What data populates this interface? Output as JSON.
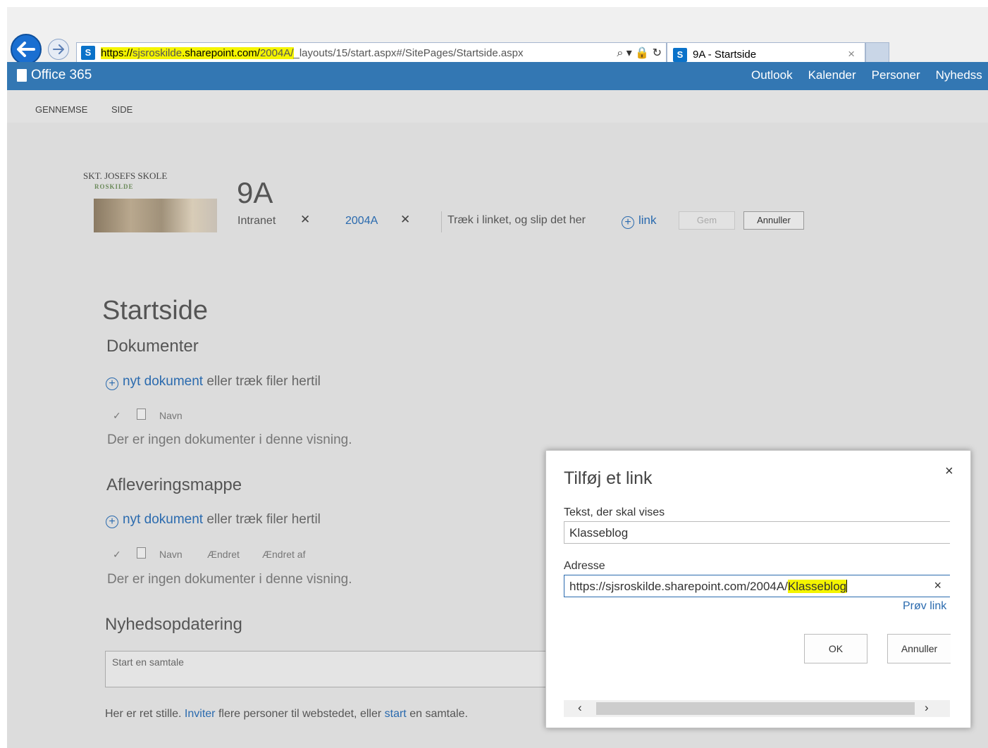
{
  "browser": {
    "url_parts": {
      "a": "https://",
      "b": "sjsroskilde",
      "c": ".sharepoint.com/",
      "d": "2004A/",
      "e": "_layouts/15/start.aspx#/SitePages/Startside.aspx"
    },
    "address_tools": "⌕ ▾ 🔒 ↻",
    "tab_title": "9A - Startside",
    "tab_close": "×",
    "icons": [
      "back-arrow-icon",
      "forward-arrow-icon",
      "sharepoint-icon",
      "search-icon",
      "lock-icon",
      "refresh-icon",
      "close-icon"
    ]
  },
  "suite": {
    "brand": "Office 365",
    "nav": [
      "Outlook",
      "Kalender",
      "Personer",
      "Nyhedss"
    ]
  },
  "ribbon": {
    "tabs": [
      "GENNEMSE",
      "SIDE"
    ]
  },
  "site": {
    "logo_line1": "SKT. JOSEFS SKOLE",
    "logo_line2": "ROSKILDE",
    "title": "9A",
    "breadcrumb_1": "Intranet",
    "breadcrumb_2": "2004A",
    "remove_glyph": "✕",
    "drag_hint": "Træk i linket, og slip det her",
    "add_link": "link",
    "save": "Gem",
    "cancel": "Annuller"
  },
  "main": {
    "page_title": "Startside",
    "sections": [
      {
        "title": "Dokumenter",
        "new_link": "nyt dokument",
        "new_rest": " eller træk filer hertil",
        "columns": [
          "Navn"
        ],
        "empty": "Der er ingen dokumenter i denne visning."
      },
      {
        "title": "Afleveringsmappe",
        "new_link": "nyt dokument",
        "new_rest": " eller træk filer hertil",
        "columns": [
          "Navn",
          "Ændret",
          "Ændret af"
        ],
        "empty": "Der er ingen dokumenter i denne visning."
      }
    ],
    "news_title": "Nyhedsopdatering",
    "conversation_placeholder": "Start en samtale",
    "footer": {
      "p1": "Her er ret stille. ",
      "invite": "Inviter",
      "p2": " flere personer til webstedet, eller ",
      "start": "start",
      "p3": " en samtale."
    }
  },
  "dialog": {
    "title": "Tilføj et link",
    "close": "×",
    "text_label": "Tekst, der skal vises",
    "text_value": "Klasseblog",
    "address_label": "Adresse",
    "address_prefix": "https://sjsroskilde.sharepoint.com/2004A/",
    "address_suffix": "Klasseblog",
    "clear": "×",
    "try_link": "Prøv link",
    "ok": "OK",
    "cancel": "Annuller",
    "scroll_left": "‹",
    "scroll_right": "›"
  },
  "colors": {
    "suite_bar": "#3377b3",
    "link": "#2a6aae",
    "highlight": "#f4f400",
    "ie_back": "#1a6fd1"
  }
}
